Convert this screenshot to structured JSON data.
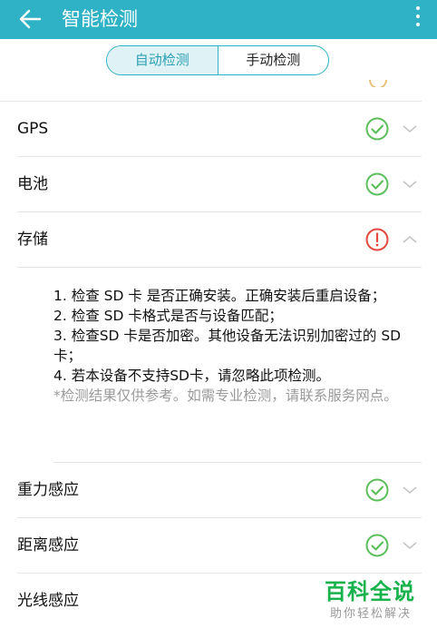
{
  "app_bar": {
    "title": "智能检测",
    "back_icon": "arrow-left-icon",
    "menu_icon": "more-vertical-icon"
  },
  "tabs": [
    {
      "label": "自动检测",
      "selected": true
    },
    {
      "label": "手动检测",
      "selected": false
    }
  ],
  "colors": {
    "accent": "#2fb2c6",
    "ok": "#5cbf5c",
    "warning": "#e5483f",
    "muted": "#9a9a9a"
  },
  "checks": [
    {
      "label": "GPS",
      "status": "ok",
      "status_icon": "check-circle-icon",
      "expanded": false
    },
    {
      "label": "电池",
      "status": "ok",
      "status_icon": "check-circle-icon",
      "expanded": false
    },
    {
      "label": "存储",
      "status": "warning",
      "status_icon": "alert-circle-icon",
      "expanded": true
    },
    {
      "label": "重力感应",
      "status": "ok",
      "status_icon": "check-circle-icon",
      "expanded": false
    },
    {
      "label": "距离感应",
      "status": "ok",
      "status_icon": "check-circle-icon",
      "expanded": false
    },
    {
      "label": "光线感应",
      "status": "",
      "expanded": false
    }
  ],
  "storage_detail": {
    "lines": [
      "1. 检查 SD 卡 是否正确安装。正确安装后重启设备；",
      "2. 检查 SD 卡格式是否与设备匹配；",
      "3. 检查SD 卡是否加密。其他设备无法识别加密过的 SD 卡；",
      "4. 若本设备不支持SD卡，请忽略此项检测。"
    ],
    "note": "*检测结果仅供参考。如需专业检测，请联系服务网点。"
  },
  "watermark": {
    "title": "百科全说",
    "subtitle": "助你轻松解决"
  }
}
